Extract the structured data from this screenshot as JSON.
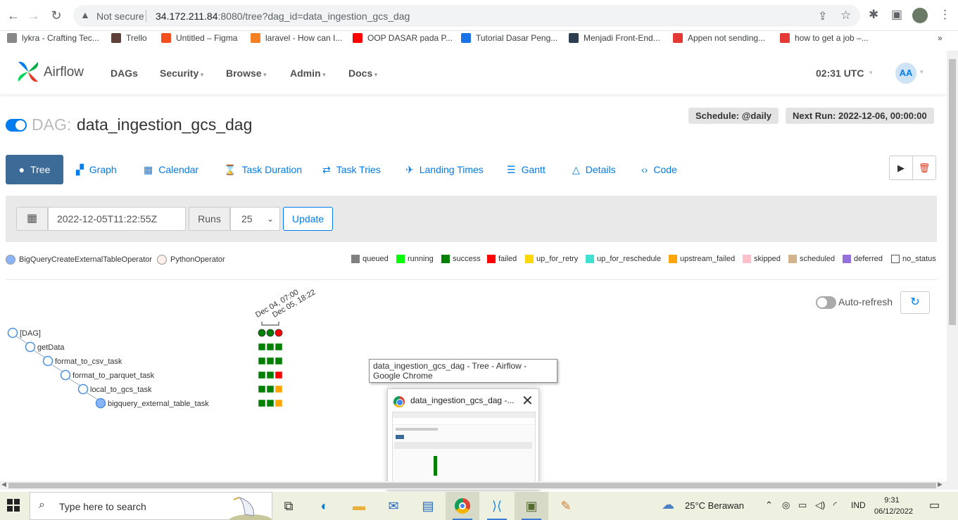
{
  "browser": {
    "security_label": "Not secure",
    "url_host": "34.172.211.84",
    "url_rest": ":8080/tree?dag_id=data_ingestion_gcs_dag",
    "bookmarks": [
      {
        "label": "lykra - Crafting Tec...",
        "icon": "lykra-icon",
        "color": "#888888"
      },
      {
        "label": "Trello",
        "icon": "trello-icon",
        "color": "#5d4037"
      },
      {
        "label": "Untitled – Figma",
        "icon": "figma-icon",
        "color": "#f24e1e"
      },
      {
        "label": "laravel - How can I...",
        "icon": "stackoverflow-icon",
        "color": "#f48024"
      },
      {
        "label": "OOP DASAR pada P...",
        "icon": "youtube-icon",
        "color": "#ff0000"
      },
      {
        "label": "Tutorial Dasar Peng...",
        "icon": "tr-icon",
        "color": "#1a73e8"
      },
      {
        "label": "Menjadi Front-End...",
        "icon": "dicoding-icon",
        "color": "#2d3e50"
      },
      {
        "label": "Appen not sending...",
        "icon": "diamond-icon",
        "color": "#e53935"
      },
      {
        "label": "how to get a job –...",
        "icon": "diamond-icon",
        "color": "#e53935"
      }
    ],
    "more_bookmarks": "»"
  },
  "airflow": {
    "brand": "Airflow",
    "menu": [
      {
        "label": "DAGs",
        "caret": false
      },
      {
        "label": "Security",
        "caret": true
      },
      {
        "label": "Browse",
        "caret": true
      },
      {
        "label": "Admin",
        "caret": true
      },
      {
        "label": "Docs",
        "caret": true
      }
    ],
    "time": "02:31 UTC",
    "user_initials": "AA"
  },
  "dag": {
    "prefix": "DAG:",
    "name": "data_ingestion_gcs_dag",
    "schedule": "Schedule: @daily",
    "next_run": "Next Run: 2022-12-06, 00:00:00",
    "paused": false
  },
  "tabs": [
    {
      "label": "Tree",
      "icon": "tree-icon",
      "active": true
    },
    {
      "label": "Graph",
      "icon": "graph-icon",
      "active": false
    },
    {
      "label": "Calendar",
      "icon": "calendar-icon",
      "active": false
    },
    {
      "label": "Task Duration",
      "icon": "hourglass-icon",
      "active": false
    },
    {
      "label": "Task Tries",
      "icon": "tries-icon",
      "active": false
    },
    {
      "label": "Landing Times",
      "icon": "landing-icon",
      "active": false
    },
    {
      "label": "Gantt",
      "icon": "gantt-icon",
      "active": false
    },
    {
      "label": "Details",
      "icon": "details-icon",
      "active": false
    },
    {
      "label": "Code",
      "icon": "code-icon",
      "active": false
    }
  ],
  "form": {
    "base_date": "2022-12-05T11:22:55Z",
    "runs_label": "Runs",
    "runs_value": "25",
    "update_label": "Update"
  },
  "operators": [
    {
      "label": "BigQueryCreateExternalTableOperator",
      "color": "#8ab4f8"
    },
    {
      "label": "PythonOperator",
      "color": "#ffefeb"
    }
  ],
  "states": [
    {
      "label": "queued",
      "color": "#808080"
    },
    {
      "label": "running",
      "color": "#00ff00"
    },
    {
      "label": "success",
      "color": "#008000"
    },
    {
      "label": "failed",
      "color": "#ff0000"
    },
    {
      "label": "up_for_retry",
      "color": "#ffd700"
    },
    {
      "label": "up_for_reschedule",
      "color": "#40e0d0"
    },
    {
      "label": "upstream_failed",
      "color": "#ffa500"
    },
    {
      "label": "skipped",
      "color": "#ffc0cb"
    },
    {
      "label": "scheduled",
      "color": "#d2b48c"
    },
    {
      "label": "deferred",
      "color": "#9370db"
    },
    {
      "label": "no_status",
      "color": "#ffffff"
    }
  ],
  "auto_refresh_label": "Auto-refresh",
  "tree": {
    "run_labels": [
      "Dec 04, 07:00",
      "Dec 05, 18:22"
    ],
    "dag_runs": [
      "success",
      "success",
      "failed"
    ],
    "tasks": [
      {
        "name": "getData",
        "operator": "PythonOperator",
        "states": [
          "success",
          "success",
          "success"
        ]
      },
      {
        "name": "format_to_csv_task",
        "operator": "PythonOperator",
        "states": [
          "success",
          "success",
          "success"
        ]
      },
      {
        "name": "format_to_parquet_task",
        "operator": "PythonOperator",
        "states": [
          "success",
          "success",
          "failed"
        ]
      },
      {
        "name": "local_to_gcs_task",
        "operator": "PythonOperator",
        "states": [
          "success",
          "success",
          "upstream_failed"
        ]
      },
      {
        "name": "bigquery_external_table_task",
        "operator": "BigQueryCreateExternalTableOperator",
        "states": [
          "success",
          "success",
          "upstream_failed"
        ]
      }
    ],
    "root_label": "[DAG]"
  },
  "tooltip": "data_ingestion_gcs_dag - Tree - Airflow - Google Chrome",
  "thumbnail_title": "data_ingestion_gcs_dag -...",
  "taskbar": {
    "search_placeholder": "Type here to search",
    "weather": "25°C  Berawan",
    "language": "IND",
    "time": "9:31",
    "date": "06/12/2022"
  }
}
